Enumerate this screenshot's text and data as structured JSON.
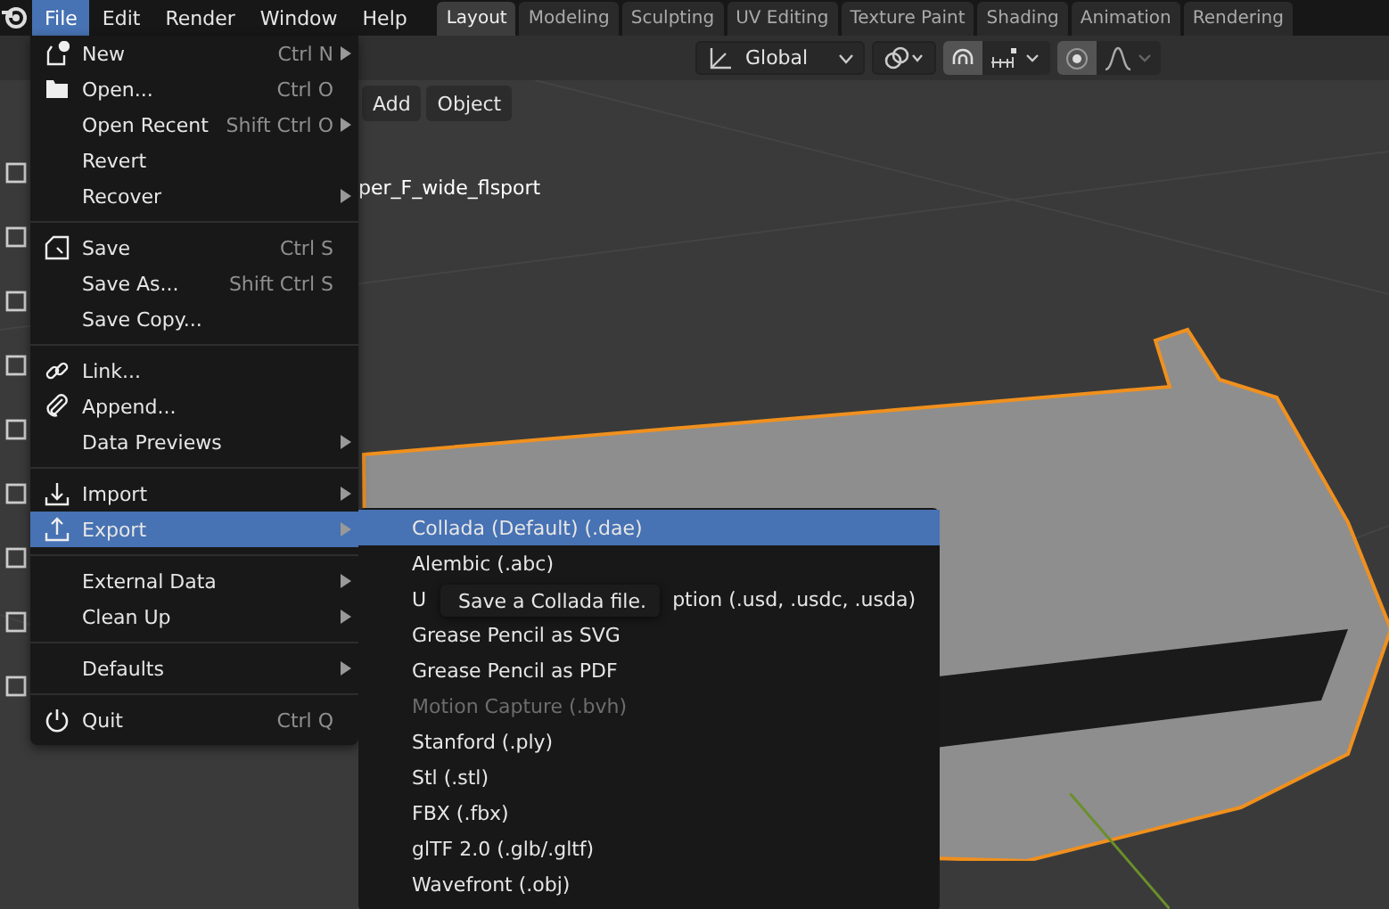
{
  "menubar": {
    "items": [
      {
        "label": "File",
        "selected": true
      },
      {
        "label": "Edit",
        "selected": false
      },
      {
        "label": "Render",
        "selected": false
      },
      {
        "label": "Window",
        "selected": false
      },
      {
        "label": "Help",
        "selected": false
      }
    ]
  },
  "workspace_tabs": [
    {
      "label": "Layout",
      "selected": true
    },
    {
      "label": "Modeling",
      "selected": false
    },
    {
      "label": "Sculpting",
      "selected": false
    },
    {
      "label": "UV Editing",
      "selected": false
    },
    {
      "label": "Texture Paint",
      "selected": false
    },
    {
      "label": "Shading",
      "selected": false
    },
    {
      "label": "Animation",
      "selected": false
    },
    {
      "label": "Rendering",
      "selected": false
    }
  ],
  "header_toolbar": {
    "orientation": "Global"
  },
  "viewport_header": {
    "buttons": [
      "Add",
      "Object"
    ]
  },
  "viewport": {
    "object_label": "per_F_wide_flsport"
  },
  "file_menu": {
    "items": [
      {
        "kind": "item",
        "label": "New",
        "shortcut": "Ctrl N",
        "submenu": true,
        "selected": false
      },
      {
        "kind": "item",
        "label": "Open...",
        "shortcut": "Ctrl O",
        "submenu": false,
        "selected": false
      },
      {
        "kind": "item",
        "label": "Open Recent",
        "shortcut": "Shift Ctrl O",
        "submenu": true,
        "selected": false
      },
      {
        "kind": "item",
        "label": "Revert",
        "submenu": false,
        "selected": false
      },
      {
        "kind": "item",
        "label": "Recover",
        "submenu": true,
        "selected": false
      },
      {
        "kind": "separator"
      },
      {
        "kind": "item",
        "label": "Save",
        "shortcut": "Ctrl S",
        "submenu": false,
        "selected": false
      },
      {
        "kind": "item",
        "label": "Save As...",
        "shortcut": "Shift Ctrl S",
        "submenu": false,
        "selected": false
      },
      {
        "kind": "item",
        "label": "Save Copy...",
        "submenu": false,
        "selected": false
      },
      {
        "kind": "separator"
      },
      {
        "kind": "item",
        "label": "Link...",
        "submenu": false,
        "selected": false
      },
      {
        "kind": "item",
        "label": "Append...",
        "submenu": false,
        "selected": false
      },
      {
        "kind": "item",
        "label": "Data Previews",
        "submenu": true,
        "selected": false
      },
      {
        "kind": "separator"
      },
      {
        "kind": "item",
        "label": "Import",
        "submenu": true,
        "selected": false
      },
      {
        "kind": "item",
        "label": "Export",
        "submenu": true,
        "selected": true
      },
      {
        "kind": "separator"
      },
      {
        "kind": "item",
        "label": "External Data",
        "submenu": true,
        "selected": false
      },
      {
        "kind": "item",
        "label": "Clean Up",
        "submenu": true,
        "selected": false
      },
      {
        "kind": "separator"
      },
      {
        "kind": "item",
        "label": "Defaults",
        "submenu": true,
        "selected": false
      },
      {
        "kind": "separator"
      },
      {
        "kind": "item",
        "label": "Quit",
        "shortcut": "Ctrl Q",
        "submenu": false,
        "selected": false
      }
    ]
  },
  "export_menu": {
    "items": [
      {
        "label": "Collada (Default) (.dae)",
        "selected": true,
        "disabled": false
      },
      {
        "label": "Alembic (.abc)",
        "selected": false,
        "disabled": false
      },
      {
        "label": "U",
        "label_tail": "ption (.usd, .usdc, .usda)",
        "selected": false,
        "disabled": false
      },
      {
        "label": "Grease Pencil as SVG",
        "selected": false,
        "disabled": false
      },
      {
        "label": "Grease Pencil as PDF",
        "selected": false,
        "disabled": false
      },
      {
        "label": "Motion Capture (.bvh)",
        "selected": false,
        "disabled": true
      },
      {
        "label": "Stanford (.ply)",
        "selected": false,
        "disabled": false
      },
      {
        "label": "Stl (.stl)",
        "selected": false,
        "disabled": false
      },
      {
        "label": "FBX (.fbx)",
        "selected": false,
        "disabled": false
      },
      {
        "label": "glTF 2.0 (.glb/.gltf)",
        "selected": false,
        "disabled": false
      },
      {
        "label": "Wavefront (.obj)",
        "selected": false,
        "disabled": false
      }
    ]
  },
  "tooltip": {
    "text": "Save a Collada file."
  }
}
